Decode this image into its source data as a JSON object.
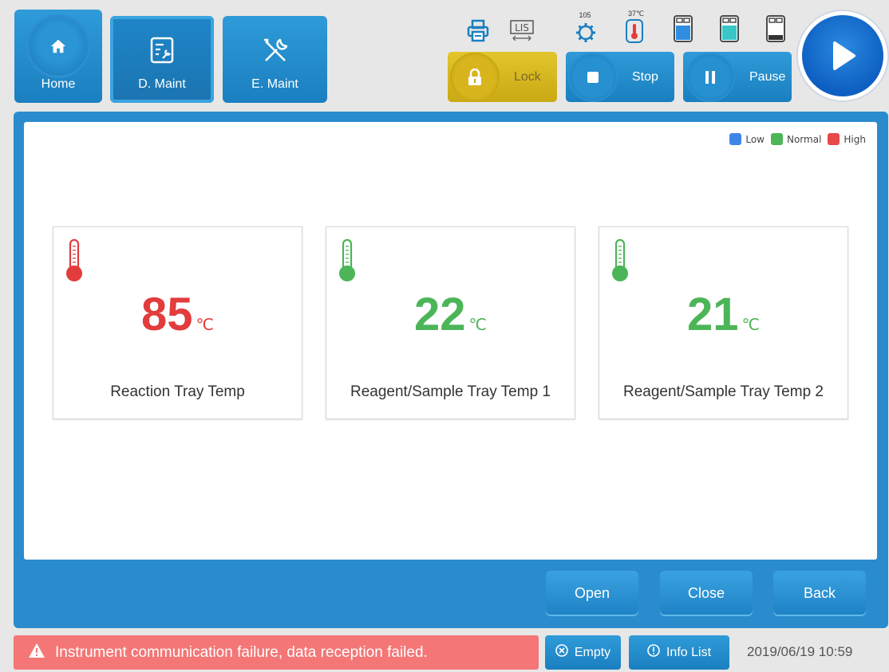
{
  "nav": {
    "home_label": "Home",
    "dmaint_label": "D. Maint",
    "emaint_label": "E. Maint"
  },
  "status_icons": {
    "gear_value": "105",
    "temp_value": "37℃",
    "lis_label": "LIS"
  },
  "controls": {
    "lock_label": "Lock",
    "stop_label": "Stop",
    "pause_label": "Pause"
  },
  "legend": [
    {
      "label": "Low",
      "color": "#3d86e8"
    },
    {
      "label": "Normal",
      "color": "#4cb558"
    },
    {
      "label": "High",
      "color": "#e8484a"
    }
  ],
  "cards": [
    {
      "value": "85",
      "unit": "℃",
      "name": "Reaction Tray Temp",
      "status": "high"
    },
    {
      "value": "22",
      "unit": "℃",
      "name": "Reagent/Sample Tray Temp 1",
      "status": "normal"
    },
    {
      "value": "21",
      "unit": "℃",
      "name": "Reagent/Sample Tray Temp 2",
      "status": "normal"
    }
  ],
  "actions": {
    "open_label": "Open",
    "close_label": "Close",
    "back_label": "Back"
  },
  "statusbar": {
    "alarm_text": "Instrument communication failure, data reception failed.",
    "empty_label": "Empty",
    "infolist_label": "Info List",
    "datetime": "2019/06/19 10:59"
  },
  "colors": {
    "accent": "#2b8ccd",
    "lock": "#d9b51d",
    "alarm": "#f47676"
  }
}
